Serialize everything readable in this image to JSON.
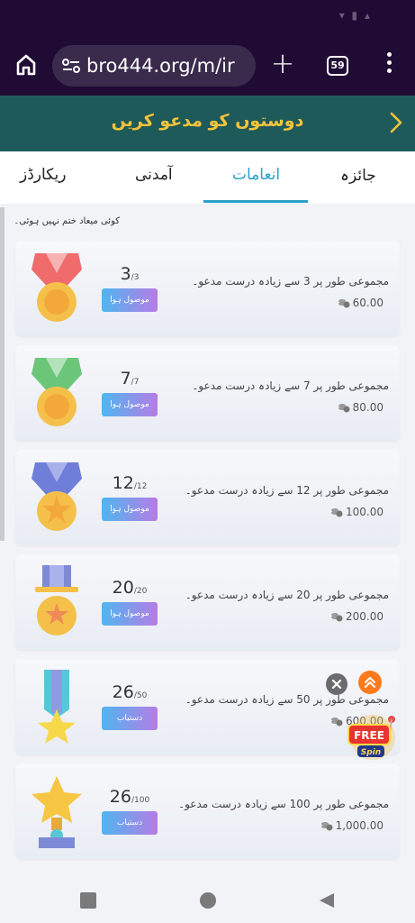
{
  "browser": {
    "url": "bro444.org/m/ir",
    "tab_count": "59"
  },
  "banner": {
    "invite_text": "دوستوں کو مدعو کریں"
  },
  "tabs": [
    {
      "label": "ریکارڈز",
      "active": false
    },
    {
      "label": "آمدنی",
      "active": false
    },
    {
      "label": "انعامات",
      "active": true
    },
    {
      "label": "جائزہ",
      "active": false
    }
  ],
  "note": "کوئی میعاد ختم نہیں ہوئی۔",
  "rewards": [
    {
      "current": "3",
      "total": "/3",
      "status": "موصول ہوا",
      "description": "مجموعی طور پر 3 سے زیادہ درست مدعو۔",
      "amount": "60.00",
      "medal_color": "#f06b6b"
    },
    {
      "current": "7",
      "total": "/7",
      "status": "موصول ہوا",
      "description": "مجموعی طور پر 7 سے زیادہ درست مدعو۔",
      "amount": "80.00",
      "medal_color": "#6cc67a"
    },
    {
      "current": "12",
      "total": "/12",
      "status": "موصول ہوا",
      "description": "مجموعی طور پر 12 سے زیادہ درست مدعو۔",
      "amount": "100.00",
      "medal_color": "#6f7ed8"
    },
    {
      "current": "20",
      "total": "/20",
      "status": "موصول ہوا",
      "description": "مجموعی طور پر 20 سے زیادہ درست مدعو۔",
      "amount": "200.00",
      "medal_color": "#7d8ad8"
    },
    {
      "current": "26",
      "total": "/50",
      "status": "دستیاب",
      "description": "مجموعی طور پر 50 سے زیادہ درست مدعو۔",
      "amount": "600.00",
      "medal_color": "#57c7d8"
    },
    {
      "current": "26",
      "total": "/100",
      "status": "دستیاب",
      "description": "مجموعی طور پر 100 سے زیادہ درست مدعو۔",
      "amount": "1,000.00",
      "medal_color": "#f7c744"
    }
  ],
  "promo": {
    "free_label": "FREE",
    "spin_label": "Spin"
  },
  "colors": {
    "header_bg": "#1f0b33",
    "banner_bg": "#1e5a5a",
    "banner_text": "#f6c33a",
    "tab_active": "#2c9fc9"
  }
}
